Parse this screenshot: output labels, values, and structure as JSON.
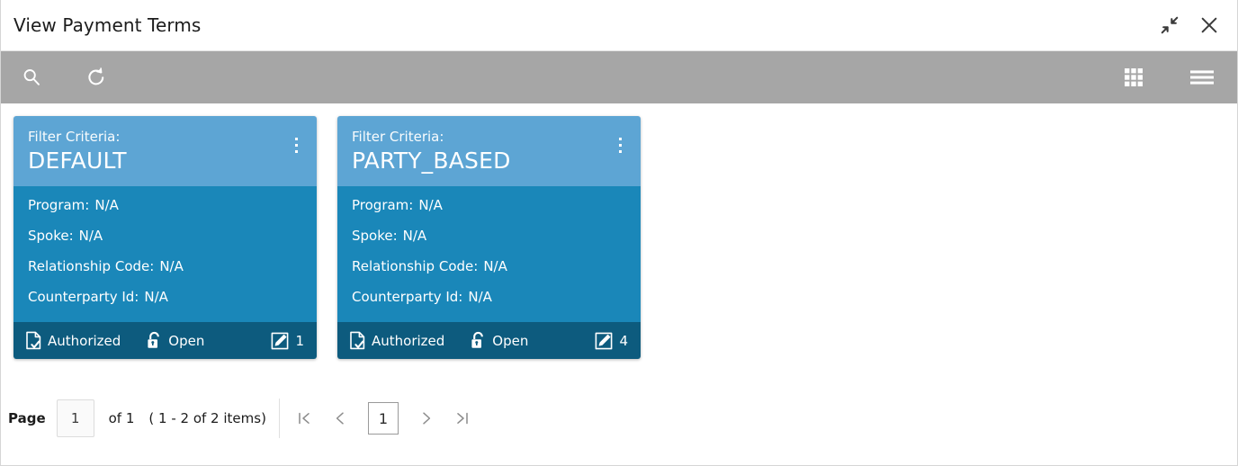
{
  "window": {
    "title": "View Payment Terms",
    "actions": [
      {
        "name": "collapse-icon",
        "label": "Collapse"
      },
      {
        "name": "close-icon",
        "label": "Close"
      }
    ]
  },
  "toolbar": {
    "left": [
      {
        "name": "search-icon",
        "label": "Search"
      },
      {
        "name": "refresh-icon",
        "label": "Refresh"
      }
    ],
    "right": [
      {
        "name": "grid-view-icon",
        "label": "Tile View"
      },
      {
        "name": "list-view-icon",
        "label": "List View"
      }
    ]
  },
  "cards": [
    {
      "criteria_label": "Filter Criteria:",
      "criteria_value": "DEFAULT",
      "menu": "kebab-menu-icon",
      "fields": [
        {
          "label": "Program:",
          "value": "N/A"
        },
        {
          "label": "Spoke:",
          "value": "N/A"
        },
        {
          "label": "Relationship Code:",
          "value": "N/A"
        },
        {
          "label": "Counterparty Id:",
          "value": "N/A"
        }
      ],
      "status": "Authorized",
      "lock_state": "Open",
      "count": "1"
    },
    {
      "criteria_label": "Filter Criteria:",
      "criteria_value": "PARTY_BASED",
      "menu": "kebab-menu-icon",
      "fields": [
        {
          "label": "Program:",
          "value": "N/A"
        },
        {
          "label": "Spoke:",
          "value": "N/A"
        },
        {
          "label": "Relationship Code:",
          "value": "N/A"
        },
        {
          "label": "Counterparty Id:",
          "value": "N/A"
        }
      ],
      "status": "Authorized",
      "lock_state": "Open",
      "count": "4"
    }
  ],
  "pagination": {
    "page_label": "Page",
    "page_value": "1",
    "of_text": "of 1",
    "range_text": "( 1 - 2 of 2 items)",
    "first_label": "First page",
    "prev_label": "Previous page",
    "current_page": "1",
    "next_label": "Next page",
    "last_label": "Last page"
  },
  "colors": {
    "card_header": "#5da5d4",
    "card_body": "#1a87b9",
    "card_footer": "#0d5b7e",
    "toolbar": "#a6a6a6"
  }
}
